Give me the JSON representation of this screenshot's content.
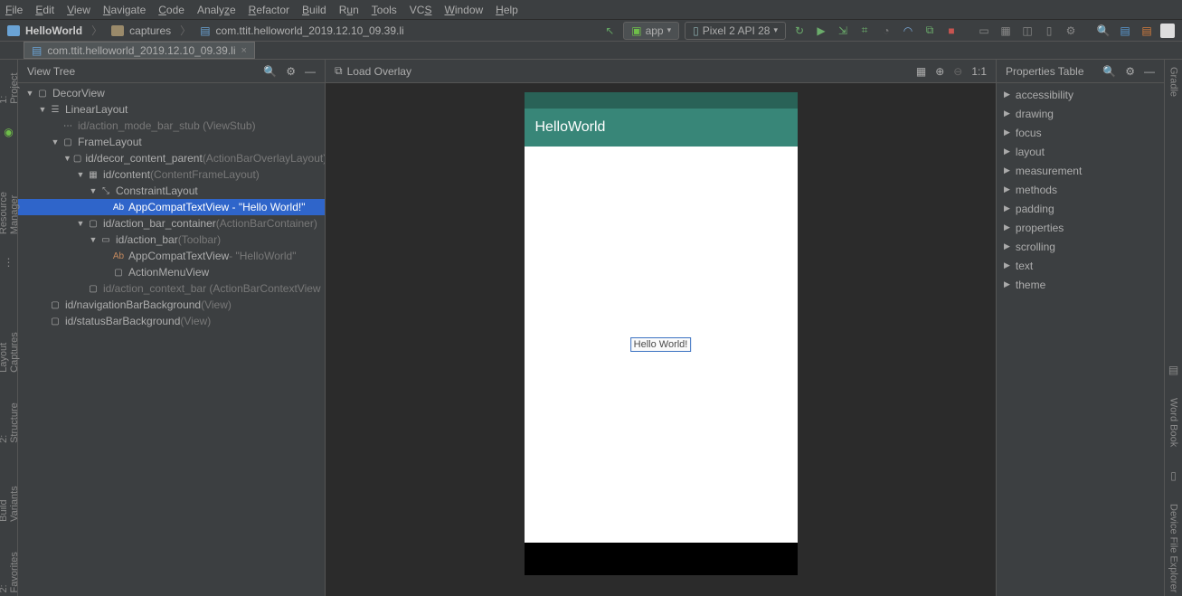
{
  "menu": {
    "file": "File",
    "edit": "Edit",
    "view": "View",
    "navigate": "Navigate",
    "code": "Code",
    "analyze": "Analyze",
    "refactor": "Refactor",
    "build": "Build",
    "run": "Run",
    "tools": "Tools",
    "vcs": "VCS",
    "window": "Window",
    "help": "Help"
  },
  "breadcrumbs": {
    "project": "HelloWorld",
    "folder": "captures",
    "file": "com.ttit.helloworld_2019.12.10_09.39.li"
  },
  "run_config": {
    "label": "app"
  },
  "device": {
    "label": "Pixel 2 API 28"
  },
  "tabs": {
    "active": "com.ttit.helloworld_2019.12.10_09.39.li"
  },
  "view_tree": {
    "title": "View Tree",
    "load_overlay": "Load Overlay",
    "zoom_label": "1:1"
  },
  "tree": [
    {
      "indent": 0,
      "tw": "▼",
      "icon": "rect",
      "label": "DecorView",
      "dim": ""
    },
    {
      "indent": 1,
      "tw": "▼",
      "icon": "lines",
      "label": "LinearLayout",
      "dim": ""
    },
    {
      "indent": 2,
      "tw": "",
      "icon": "dots",
      "label": "id/action_mode_bar_stub",
      "dim": " (ViewStub)",
      "dimLabel": true
    },
    {
      "indent": 2,
      "tw": "▼",
      "icon": "rect",
      "label": "FrameLayout",
      "dim": ""
    },
    {
      "indent": 3,
      "tw": "▼",
      "icon": "rect",
      "label": "id/decor_content_parent",
      "dim": " (ActionBarOverlayLayout)"
    },
    {
      "indent": 4,
      "tw": "▼",
      "icon": "grid",
      "label": "id/content",
      "dim": " (ContentFrameLayout)"
    },
    {
      "indent": 5,
      "tw": "▼",
      "icon": "cl",
      "label": "ConstraintLayout",
      "dim": ""
    },
    {
      "indent": 6,
      "tw": "",
      "icon": "ab",
      "label": "AppCompatTextView - \"Hello World!\"",
      "dim": "",
      "selected": true
    },
    {
      "indent": 4,
      "tw": "▼",
      "icon": "rect",
      "label": "id/action_bar_container",
      "dim": " (ActionBarContainer)"
    },
    {
      "indent": 5,
      "tw": "▼",
      "icon": "bar",
      "label": "id/action_bar",
      "dim": " (Toolbar)"
    },
    {
      "indent": 6,
      "tw": "",
      "icon": "ab",
      "label": "AppCompatTextView",
      "dim": " - \"HelloWorld\""
    },
    {
      "indent": 6,
      "tw": "",
      "icon": "rect",
      "label": "ActionMenuView",
      "dim": ""
    },
    {
      "indent": 4,
      "tw": "",
      "icon": "rect",
      "label": "id/action_context_bar",
      "dim": " (ActionBarContextView",
      "dimLabel": true
    },
    {
      "indent": 1,
      "tw": "",
      "icon": "rect",
      "label": "id/navigationBarBackground",
      "dim": " (View)"
    },
    {
      "indent": 1,
      "tw": "",
      "icon": "rect",
      "label": "id/statusBarBackground",
      "dim": " (View)"
    }
  ],
  "preview": {
    "app_title": "HelloWorld",
    "text": "Hello World!"
  },
  "properties": {
    "title": "Properties Table",
    "items": [
      "accessibility",
      "drawing",
      "focus",
      "layout",
      "measurement",
      "methods",
      "padding",
      "properties",
      "scrolling",
      "text",
      "theme"
    ]
  },
  "gutters": {
    "left": [
      {
        "label": "1: Project",
        "icon": "●"
      },
      {
        "label": "Resource Manager",
        "icon": "⧉"
      },
      {
        "label": "⋮"
      },
      {
        "label": "Layout Captures",
        "icon": "▤"
      },
      {
        "label": "2: Structure",
        "icon": "▤"
      },
      {
        "label": "Build Variants",
        "icon": "☰"
      },
      {
        "label": "2: Favorites",
        "icon": "★"
      }
    ],
    "right": [
      {
        "label": "Gradle"
      },
      {
        "label": "Word Book",
        "icon": "▤"
      },
      {
        "label": "Device File Explorer",
        "icon": "▯"
      }
    ]
  }
}
